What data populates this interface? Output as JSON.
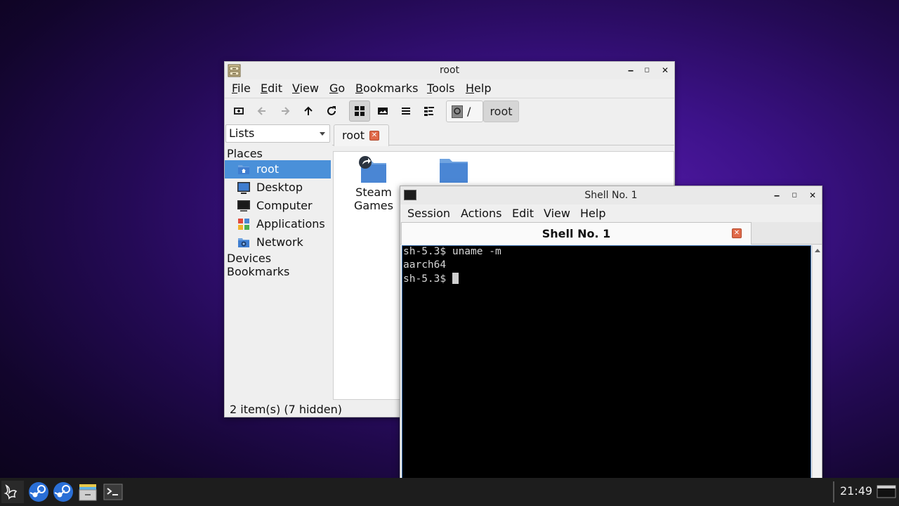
{
  "file_manager": {
    "title": "root",
    "menu": [
      "File",
      "Edit",
      "View",
      "Go",
      "Bookmarks",
      "Tools",
      "Help"
    ],
    "path_segments": [
      "/",
      "root"
    ],
    "side_pane_mode": "Lists",
    "places_header": "Places",
    "places": [
      {
        "label": "root",
        "icon": "home-folder-icon",
        "selected": true
      },
      {
        "label": "Desktop",
        "icon": "desktop-icon",
        "selected": false
      },
      {
        "label": "Computer",
        "icon": "computer-icon",
        "selected": false
      },
      {
        "label": "Applications",
        "icon": "applications-icon",
        "selected": false
      },
      {
        "label": "Network",
        "icon": "network-icon",
        "selected": false
      }
    ],
    "devices_header": "Devices",
    "bookmarks_header": "Bookmarks",
    "tab_label": "root",
    "files": [
      {
        "name": "Steam Games",
        "line1": "Steam",
        "line2": "Games",
        "icon": "folder-link-icon"
      },
      {
        "name": "",
        "line1": "",
        "line2": "",
        "icon": "folder-icon"
      }
    ],
    "status": "2 item(s) (7 hidden)"
  },
  "terminal": {
    "title": "Shell No. 1",
    "menu": [
      "Session",
      "Actions",
      "Edit",
      "View",
      "Help"
    ],
    "tab_label": "Shell No. 1",
    "lines": [
      "sh-5.3$ uname -m",
      "aarch64",
      "sh-5.3$ "
    ]
  },
  "taskbar": {
    "clock": "21:49",
    "items": [
      "app-menu-icon",
      "steam-icon",
      "steam-icon",
      "file-manager-icon",
      "terminal-icon"
    ]
  },
  "colors": {
    "selection": "#4a90d9",
    "folder": "#4a86d4",
    "close_tab": "#e06a4a"
  }
}
